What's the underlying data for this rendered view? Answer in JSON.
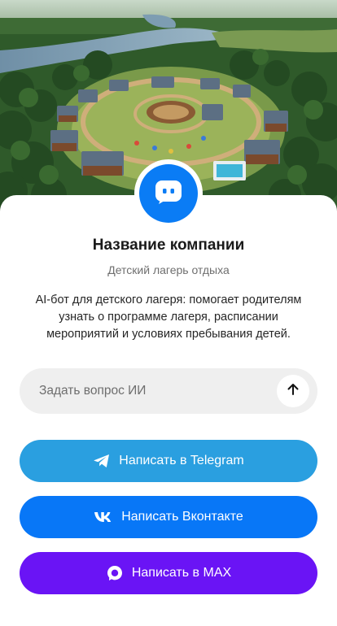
{
  "company": {
    "name": "Название компании",
    "subtitle": "Детский лагерь отдыха",
    "description": "AI-бот для детского лагеря: помогает родителям узнать о программе лагеря, расписании мероприятий и условиях пребывания детей."
  },
  "ask": {
    "placeholder": "Задать вопрос ИИ",
    "value": "",
    "send_icon": "arrow-up-icon"
  },
  "actions": {
    "telegram": {
      "label": "Написать в Telegram",
      "icon": "telegram-icon",
      "color": "#2a9fe0"
    },
    "vk": {
      "label": "Написать Вконтакте",
      "icon": "vk-icon",
      "color": "#0877f7"
    },
    "max": {
      "label": "Написать в MAX",
      "icon": "max-icon",
      "color": "#6a14f5"
    }
  },
  "avatar": {
    "icon": "chat-bot-icon",
    "color": "#0a7cf5"
  },
  "hero": {
    "image": "summer-camp-aerial-photo"
  }
}
